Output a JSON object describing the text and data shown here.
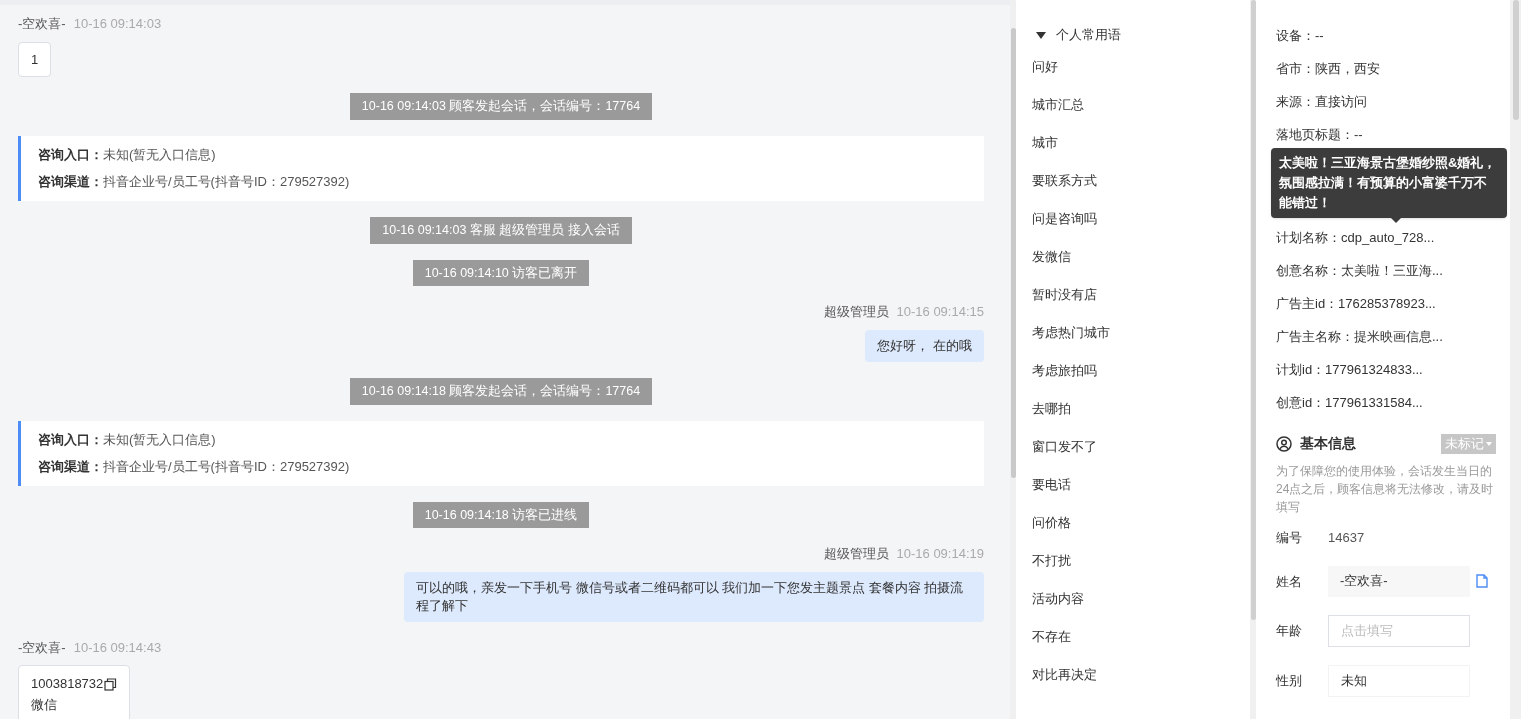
{
  "chat": {
    "messages": [
      {
        "kind": "customer",
        "name": "-空欢喜-",
        "time": "10-16 09:14:03",
        "text": "1"
      },
      {
        "kind": "system",
        "text": "10-16 09:14:03 顾客发起会话，会话编号：17764"
      },
      {
        "kind": "info",
        "rows": [
          {
            "label": "咨询入口：",
            "value": "未知(暂无入口信息)"
          },
          {
            "label": "咨询渠道：",
            "value": "抖音企业号/员工号(抖音号ID：279527392)"
          }
        ]
      },
      {
        "kind": "system",
        "text": "10-16 09:14:03 客服 超级管理员 接入会话"
      },
      {
        "kind": "system",
        "text": "10-16 09:14:10 访客已离开"
      },
      {
        "kind": "agent",
        "name": "超级管理员",
        "time": "10-16 09:14:15",
        "text": "您好呀， 在的哦"
      },
      {
        "kind": "system",
        "text": "10-16 09:14:18 顾客发起会话，会话编号：17764"
      },
      {
        "kind": "info",
        "rows": [
          {
            "label": "咨询入口：",
            "value": "未知(暂无入口信息)"
          },
          {
            "label": "咨询渠道：",
            "value": "抖音企业号/员工号(抖音号ID：279527392)"
          }
        ]
      },
      {
        "kind": "system",
        "text": "10-16 09:14:18 访客已进线"
      },
      {
        "kind": "agent",
        "name": "超级管理员",
        "time": "10-16 09:14:19",
        "text": "可以的哦，亲发一下手机号 微信号或者二维码都可以 我们加一下您发主题景点 套餐内容 拍摄流程了解下"
      },
      {
        "kind": "contact",
        "name": "-空欢喜-",
        "time": "10-16 09:14:43",
        "number": "1003818732",
        "label": "微信"
      }
    ]
  },
  "phrases": {
    "title": "个人常用语",
    "expanded": true,
    "items": [
      "问好",
      "城市汇总",
      "城市",
      "要联系方式",
      "问是咨询吗",
      "发微信",
      "暂时没有店",
      "考虑热门城市",
      "考虑旅拍吗",
      "去哪拍",
      "窗口发不了",
      "要电话",
      "问价格",
      "不打扰",
      "活动内容",
      "不存在",
      "对比再决定"
    ]
  },
  "source_info": {
    "rows_before": [
      "设备：--",
      "省市：陕西，西安",
      "来源：直接访问",
      "落地页标题：--"
    ],
    "tooltip": "太美啦！三亚海景古堡婚纱照&婚礼，氛围感拉满！有预算的小富婆千万不能错过！",
    "rows_after": [
      "计划名称：cdp_auto_728...",
      "创意名称：太美啦！三亚海...",
      "广告主id：176285378923...",
      "广告主名称：提米映画信息...",
      "计划id：177961324833...",
      "创意id：177961331584..."
    ]
  },
  "basic_info": {
    "title": "基本信息",
    "tag": "未标记",
    "note": "为了保障您的使用体验，会话发生当日的24点之后，顾客信息将无法修改，请及时填写",
    "fields": [
      {
        "kind": "text",
        "label": "编号",
        "value": "14637"
      },
      {
        "kind": "copy",
        "label": "姓名",
        "value": "-空欢喜-"
      },
      {
        "kind": "input",
        "label": "年龄",
        "placeholder": "点击填写"
      },
      {
        "kind": "plain",
        "label": "性别",
        "value": "未知"
      }
    ]
  }
}
